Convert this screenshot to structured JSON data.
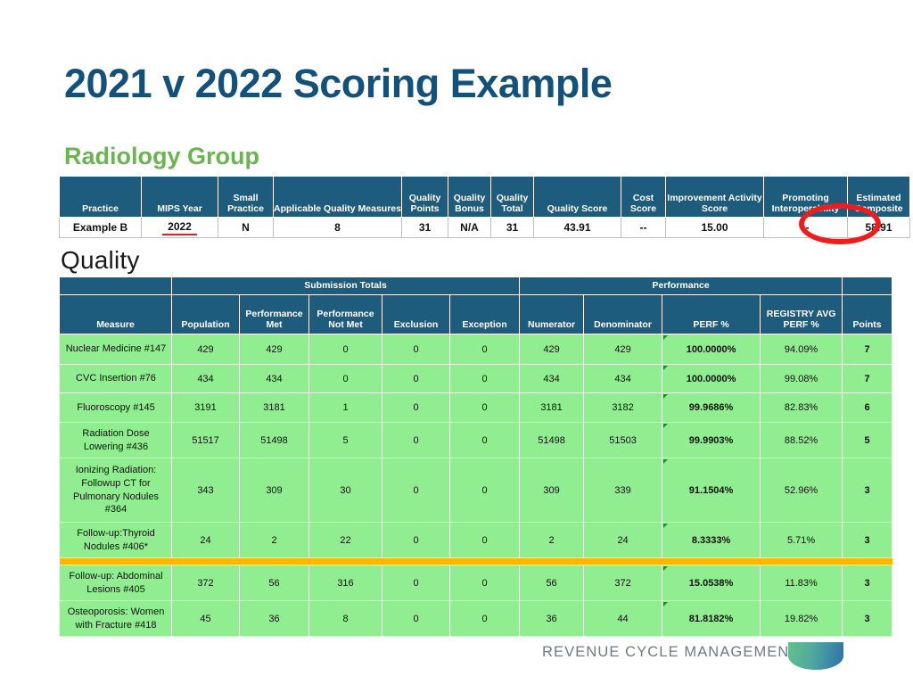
{
  "slide": {
    "title": "2021 v 2022 Scoring Example",
    "subtitle": "Radiology Group",
    "section_heading": "Quality",
    "footer_text": "REVENUE CYCLE MANAGEMENT",
    "colors": {
      "title_blue": "#14517a",
      "subtitle_green": "#6cb354",
      "header_teal": "#1d5c7d",
      "row_green": "#90ee90",
      "notmet_zero_green": "#d8f0df",
      "notmet_bad_pink": "#fbcdd4",
      "highlight_yellow": "#fdf6a9",
      "highlight_orange": "#fac46a",
      "divider_orange": "#ffb600",
      "annotation_red": "#ee1c1c"
    }
  },
  "summary_table": {
    "headers": [
      "Practice",
      "MIPS Year",
      "Small Practice",
      "Applicable Quality Measures",
      "Quality Points",
      "Quality Bonus",
      "Quality Total",
      "Quality Score",
      "Cost Score",
      "Improvement Activity Score",
      "Promoting Interoperability",
      "Estimated Composite"
    ],
    "row": {
      "practice": "Example B",
      "mips_year": "2022",
      "small_practice": "N",
      "applicable_quality_measures": "8",
      "quality_points": "31",
      "quality_bonus": "N/A",
      "quality_total": "31",
      "quality_score": "43.91",
      "cost_score": "--",
      "improvement_activity_score": "15.00",
      "promoting_interoperability": "--",
      "estimated_composite": "58.91"
    }
  },
  "quality_table": {
    "group_headers": [
      "Submission Totals",
      "Performance"
    ],
    "headers": [
      "Measure",
      "Population",
      "Performance Met",
      "Performance Not Met",
      "Exclusion",
      "Exception",
      "Numerator",
      "Denominator",
      "PERF %",
      "REGISTRY AVG PERF %",
      "Points"
    ],
    "rows": [
      {
        "measure": "Nuclear Medicine #147",
        "population": "429",
        "perf_met": "429",
        "perf_not_met": "0",
        "not_met_state": "zero",
        "exclusion": "0",
        "exception": "0",
        "numerator": "429",
        "denominator": "429",
        "perf_pct": "100.0000%",
        "registry_avg": "94.09%",
        "points": "7"
      },
      {
        "measure": "CVC Insertion #76",
        "population": "434",
        "perf_met": "434",
        "perf_not_met": "0",
        "not_met_state": "zero",
        "exclusion": "0",
        "exception": "0",
        "numerator": "434",
        "denominator": "434",
        "perf_pct": "100.0000%",
        "registry_avg": "99.08%",
        "points": "7"
      },
      {
        "measure": "Fluoroscopy #145",
        "population": "3191",
        "perf_met": "3181",
        "perf_not_met": "1",
        "not_met_state": "bad",
        "exclusion": "0",
        "exception": "0",
        "numerator": "3181",
        "denominator": "3182",
        "perf_pct": "99.9686%",
        "registry_avg": "82.83%",
        "points": "6"
      },
      {
        "measure": "Radiation Dose Lowering #436",
        "population": "51517",
        "perf_met": "51498",
        "perf_not_met": "5",
        "not_met_state": "bad",
        "exclusion": "0",
        "exception": "0",
        "numerator": "51498",
        "denominator": "51503",
        "perf_pct": "99.9903%",
        "registry_avg": "88.52%",
        "points": "5"
      },
      {
        "measure": "Ionizing Radiation: Followup CT for Pulmonary Nodules #364",
        "population": "343",
        "perf_met": "309",
        "perf_not_met": "30",
        "not_met_state": "bad",
        "exclusion": "0",
        "exception": "0",
        "numerator": "309",
        "denominator": "339",
        "perf_pct": "91.1504%",
        "registry_avg": "52.96%",
        "points": "3"
      },
      {
        "measure": "Follow-up:Thyroid Nodules #406*",
        "population": "24",
        "perf_met": "2",
        "perf_not_met": "22",
        "not_met_state": "bad",
        "exclusion": "0",
        "exception": "0",
        "numerator": "2",
        "denominator": "24",
        "perf_pct": "8.3333%",
        "registry_avg": "5.71%",
        "points": "3"
      },
      {
        "measure": "Follow-up: Abdominal Lesions #405",
        "population": "372",
        "perf_met": "56",
        "perf_not_met": "316",
        "not_met_state": "bad",
        "exclusion": "0",
        "exception": "0",
        "numerator": "56",
        "denominator": "372",
        "perf_pct": "15.0538%",
        "registry_avg": "11.83%",
        "points": "3"
      },
      {
        "measure": "Osteoporosis: Women with Fracture #418",
        "population": "45",
        "perf_met": "36",
        "perf_not_met": "8",
        "not_met_state": "bad",
        "exclusion": "0",
        "exception": "0",
        "numerator": "36",
        "denominator": "44",
        "perf_pct": "81.8182%",
        "registry_avg": "19.82%",
        "points": "3"
      }
    ],
    "divider_after_row_index": 5
  }
}
